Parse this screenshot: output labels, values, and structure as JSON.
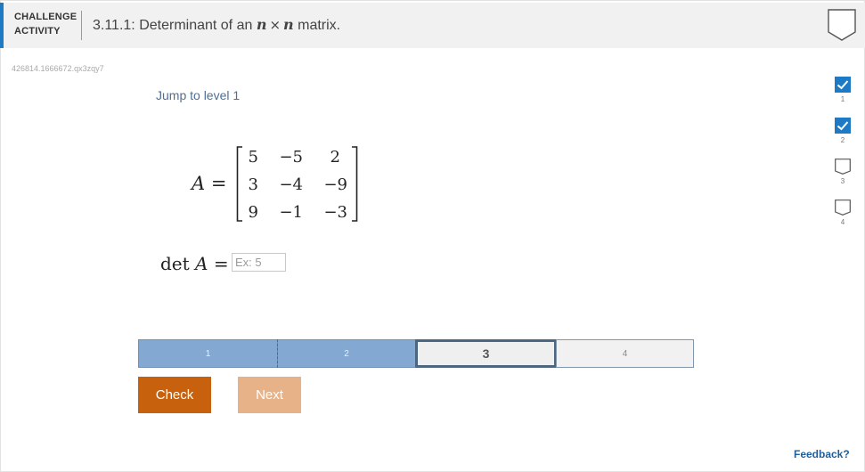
{
  "header": {
    "activity_label_line1": "CHALLENGE",
    "activity_label_line2": "ACTIVITY",
    "title_prefix": "3.11.1: Determinant of an ",
    "title_var1": "n",
    "title_times": "×",
    "title_var2": "n",
    "title_suffix": " matrix.",
    "accent_color": "#1e7ac4"
  },
  "activity_id": "426814.1666672.qx3zqy7",
  "jump_link": "Jump to level 1",
  "matrix": {
    "name": "A",
    "equals": "=",
    "rows": [
      [
        "5",
        "−5",
        "2"
      ],
      [
        "3",
        "−4",
        "−9"
      ],
      [
        "9",
        "−1",
        "−3"
      ]
    ]
  },
  "determinant": {
    "label_det": "det",
    "label_var": "A",
    "label_equals": "=",
    "input_value": "",
    "input_placeholder": "Ex: 5"
  },
  "levels": [
    {
      "label": "1",
      "state": "completed"
    },
    {
      "label": "2",
      "state": "completed"
    },
    {
      "label": "3",
      "state": "current"
    },
    {
      "label": "4",
      "state": "locked"
    }
  ],
  "buttons": {
    "check_label": "Check",
    "next_label": "Next",
    "check_color": "#c8610d",
    "next_color": "#e8b288"
  },
  "feedback_link": "Feedback?",
  "progress": [
    {
      "label": "1",
      "checked": true
    },
    {
      "label": "2",
      "checked": true
    },
    {
      "label": "3",
      "checked": false
    },
    {
      "label": "4",
      "checked": false
    }
  ]
}
